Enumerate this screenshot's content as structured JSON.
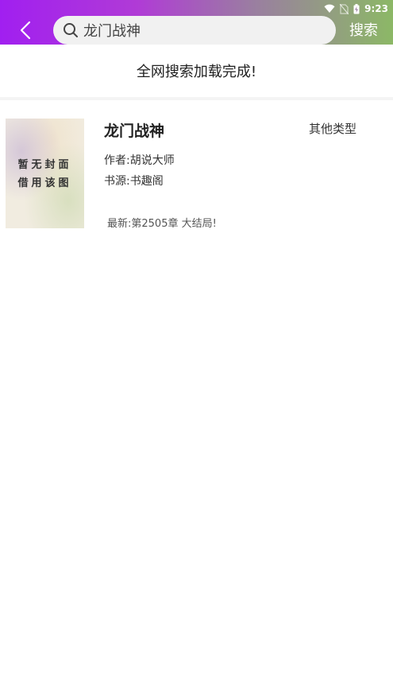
{
  "status_bar": {
    "time": "9:23",
    "icons": [
      "wifi-icon",
      "no-sim-icon",
      "battery-charging-icon"
    ]
  },
  "header": {
    "back_icon": "chevron-left-icon",
    "search": {
      "icon": "search-icon",
      "value": "龙门战神"
    },
    "search_button_label": "搜索"
  },
  "status_message": "全网搜索加载完成!",
  "results": [
    {
      "cover_line1": "暂无封面",
      "cover_line2": "借用该图",
      "title": "龙门战神",
      "category": "其他类型",
      "author": "作者:胡说大师",
      "source": "书源:书趣阁",
      "latest": "最新:第2505章 大结局!"
    }
  ],
  "colors": {
    "header_gradient_start": "#a11ff0",
    "header_gradient_end": "#8cb866",
    "search_box_bg": "#f1f1f1"
  }
}
